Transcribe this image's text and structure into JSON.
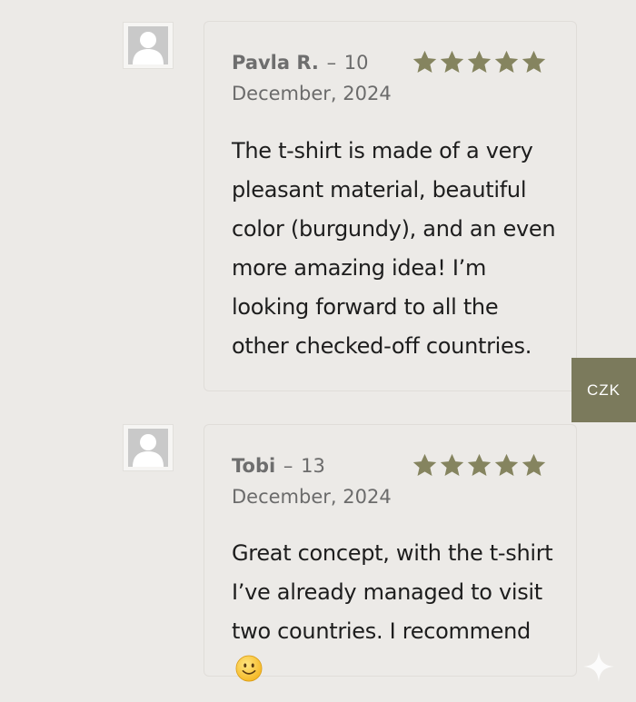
{
  "reviews": [
    {
      "author": "Pavla R.",
      "date_line1": "10",
      "date_line2": "December, 2024",
      "rating": 5,
      "text": "The t-shirt is made of a very pleasant material, beautiful color (burgundy), and an even more amazing idea! I’m looking forward to all the other checked-off countries."
    },
    {
      "author": "Tobi",
      "date_line1": "13",
      "date_line2": "December, 2024",
      "rating": 5,
      "text": "Great concept, with the t-shirt I’ve already managed to visit two countries. I recommend"
    }
  ],
  "currency_button": {
    "label": "CZK"
  },
  "colors": {
    "star": "#85845f",
    "accent": "#7b7a5c",
    "background": "#eceae7"
  },
  "icons": {
    "avatar": "user-placeholder-icon",
    "star": "star-icon",
    "emoji": "smiling-face-emoji-icon",
    "sparkle": "sparkle-icon"
  }
}
